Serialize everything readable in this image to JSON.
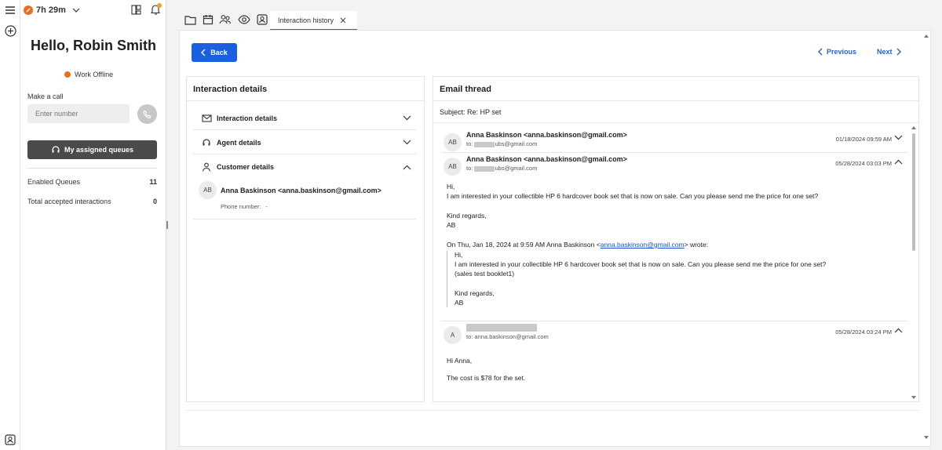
{
  "agent": {
    "timer": "7h 29m",
    "greeting": "Hello, Robin Smith",
    "status": "Work Offline",
    "make_call_label": "Make a call",
    "number_placeholder": "Enter number",
    "queues_button": "My assigned queues",
    "stats": [
      {
        "label": "Enabled Queues",
        "value": "11"
      },
      {
        "label": "Total accepted interactions",
        "value": "0"
      }
    ]
  },
  "tabs": {
    "active_label": "Interaction history",
    "icons": [
      "folder-icon",
      "calendar-icon",
      "contacts-icon",
      "eye-icon",
      "contact-card-icon"
    ]
  },
  "toolbar": {
    "back_label": "Back",
    "previous_label": "Previous",
    "next_label": "Next"
  },
  "details": {
    "title": "Interaction details",
    "sections": [
      {
        "label": "Interaction details",
        "icon": "mail-icon",
        "expanded": false
      },
      {
        "label": "Agent details",
        "icon": "headset-icon",
        "expanded": false
      },
      {
        "label": "Customer details",
        "icon": "person-icon",
        "expanded": true
      }
    ],
    "customer": {
      "initials": "AB",
      "name": "Anna Baskinson <anna.baskinson@gmail.com>",
      "phone_label": "Phone number:",
      "phone_value": "-"
    }
  },
  "thread": {
    "title": "Email thread",
    "subject": "Subject: Re: HP set",
    "messages": [
      {
        "initials": "AB",
        "from": "Anna Baskinson <anna.baskinson@gmail.com>",
        "to_prefix": "to:",
        "to_suffix": "ubs@gmail.com",
        "date": "01/18/2024 09:59 AM"
      },
      {
        "initials": "AB",
        "from": "Anna Baskinson <anna.baskinson@gmail.com>",
        "to_prefix": "to:",
        "to_suffix": "ubs@gmail.com",
        "date": "05/28/2024 03:03 PM",
        "body": [
          "Hi,",
          "I am interested in your collectible HP 6 hardcover book set that is now on sale. Can you please send me the price for one set?",
          "Kind regards,",
          "AB"
        ],
        "quote_intro_before": "On Thu, Jan 18, 2024 at 9:59 AM Anna Baskinson <",
        "quote_link": "anna.baskinson@gmail.com",
        "quote_intro_after": "> wrote:",
        "quote": [
          "Hi,",
          "I am interested in your collectible HP 6 hardcover book set that is now on sale. Can you please send me the price for one set?",
          "(sales test booklet1)",
          "Kind regards,",
          "AB"
        ]
      },
      {
        "initials": "A",
        "to": "to: anna.baskinson@gmail.com",
        "date": "05/28/2024 03:24 PM",
        "body": [
          "Hi Anna,",
          "The cost is $78 for the set."
        ]
      }
    ]
  }
}
